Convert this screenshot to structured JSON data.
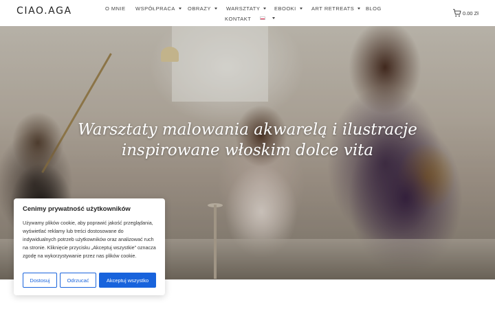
{
  "header": {
    "logo": "CIAO.AGA",
    "nav": [
      {
        "label": "O MNIE",
        "dropdown": false
      },
      {
        "label": "WSPÓŁPRACA",
        "dropdown": true
      },
      {
        "label": "OBRAZY",
        "dropdown": true
      },
      {
        "label": "WARSZTATY",
        "dropdown": true
      },
      {
        "label": "EBOOKI",
        "dropdown": true
      },
      {
        "label": "ART RETREATS",
        "dropdown": true
      },
      {
        "label": "BLOG",
        "dropdown": false
      },
      {
        "label": "KONTAKT",
        "dropdown": false
      }
    ],
    "language_icon": "polish-flag-icon",
    "cart_icon": "shopping-cart-icon",
    "cart_amount": "0.00 Zł"
  },
  "hero": {
    "title": "Warsztaty malowania akwarelą i ilustracje inspirowane włoskim dolce vita"
  },
  "cookie": {
    "title": "Cenimy prywatność użytkowników",
    "text": "Używamy plików cookie, aby poprawić jakość przeglądania, wyświetlać reklamy lub treści dostosowane do indywidualnych potrzeb użytkowników oraz analizować ruch na stronie. Kliknięcie przycisku „Akceptuj wszystkie” oznacza zgodę na wykorzystywanie przez nas plików cookie.",
    "customize_label": "Dostosuj",
    "reject_label": "Odrzucać",
    "accept_label": "Akceptuj wszystko"
  },
  "colors": {
    "accent": "#1863dc"
  }
}
